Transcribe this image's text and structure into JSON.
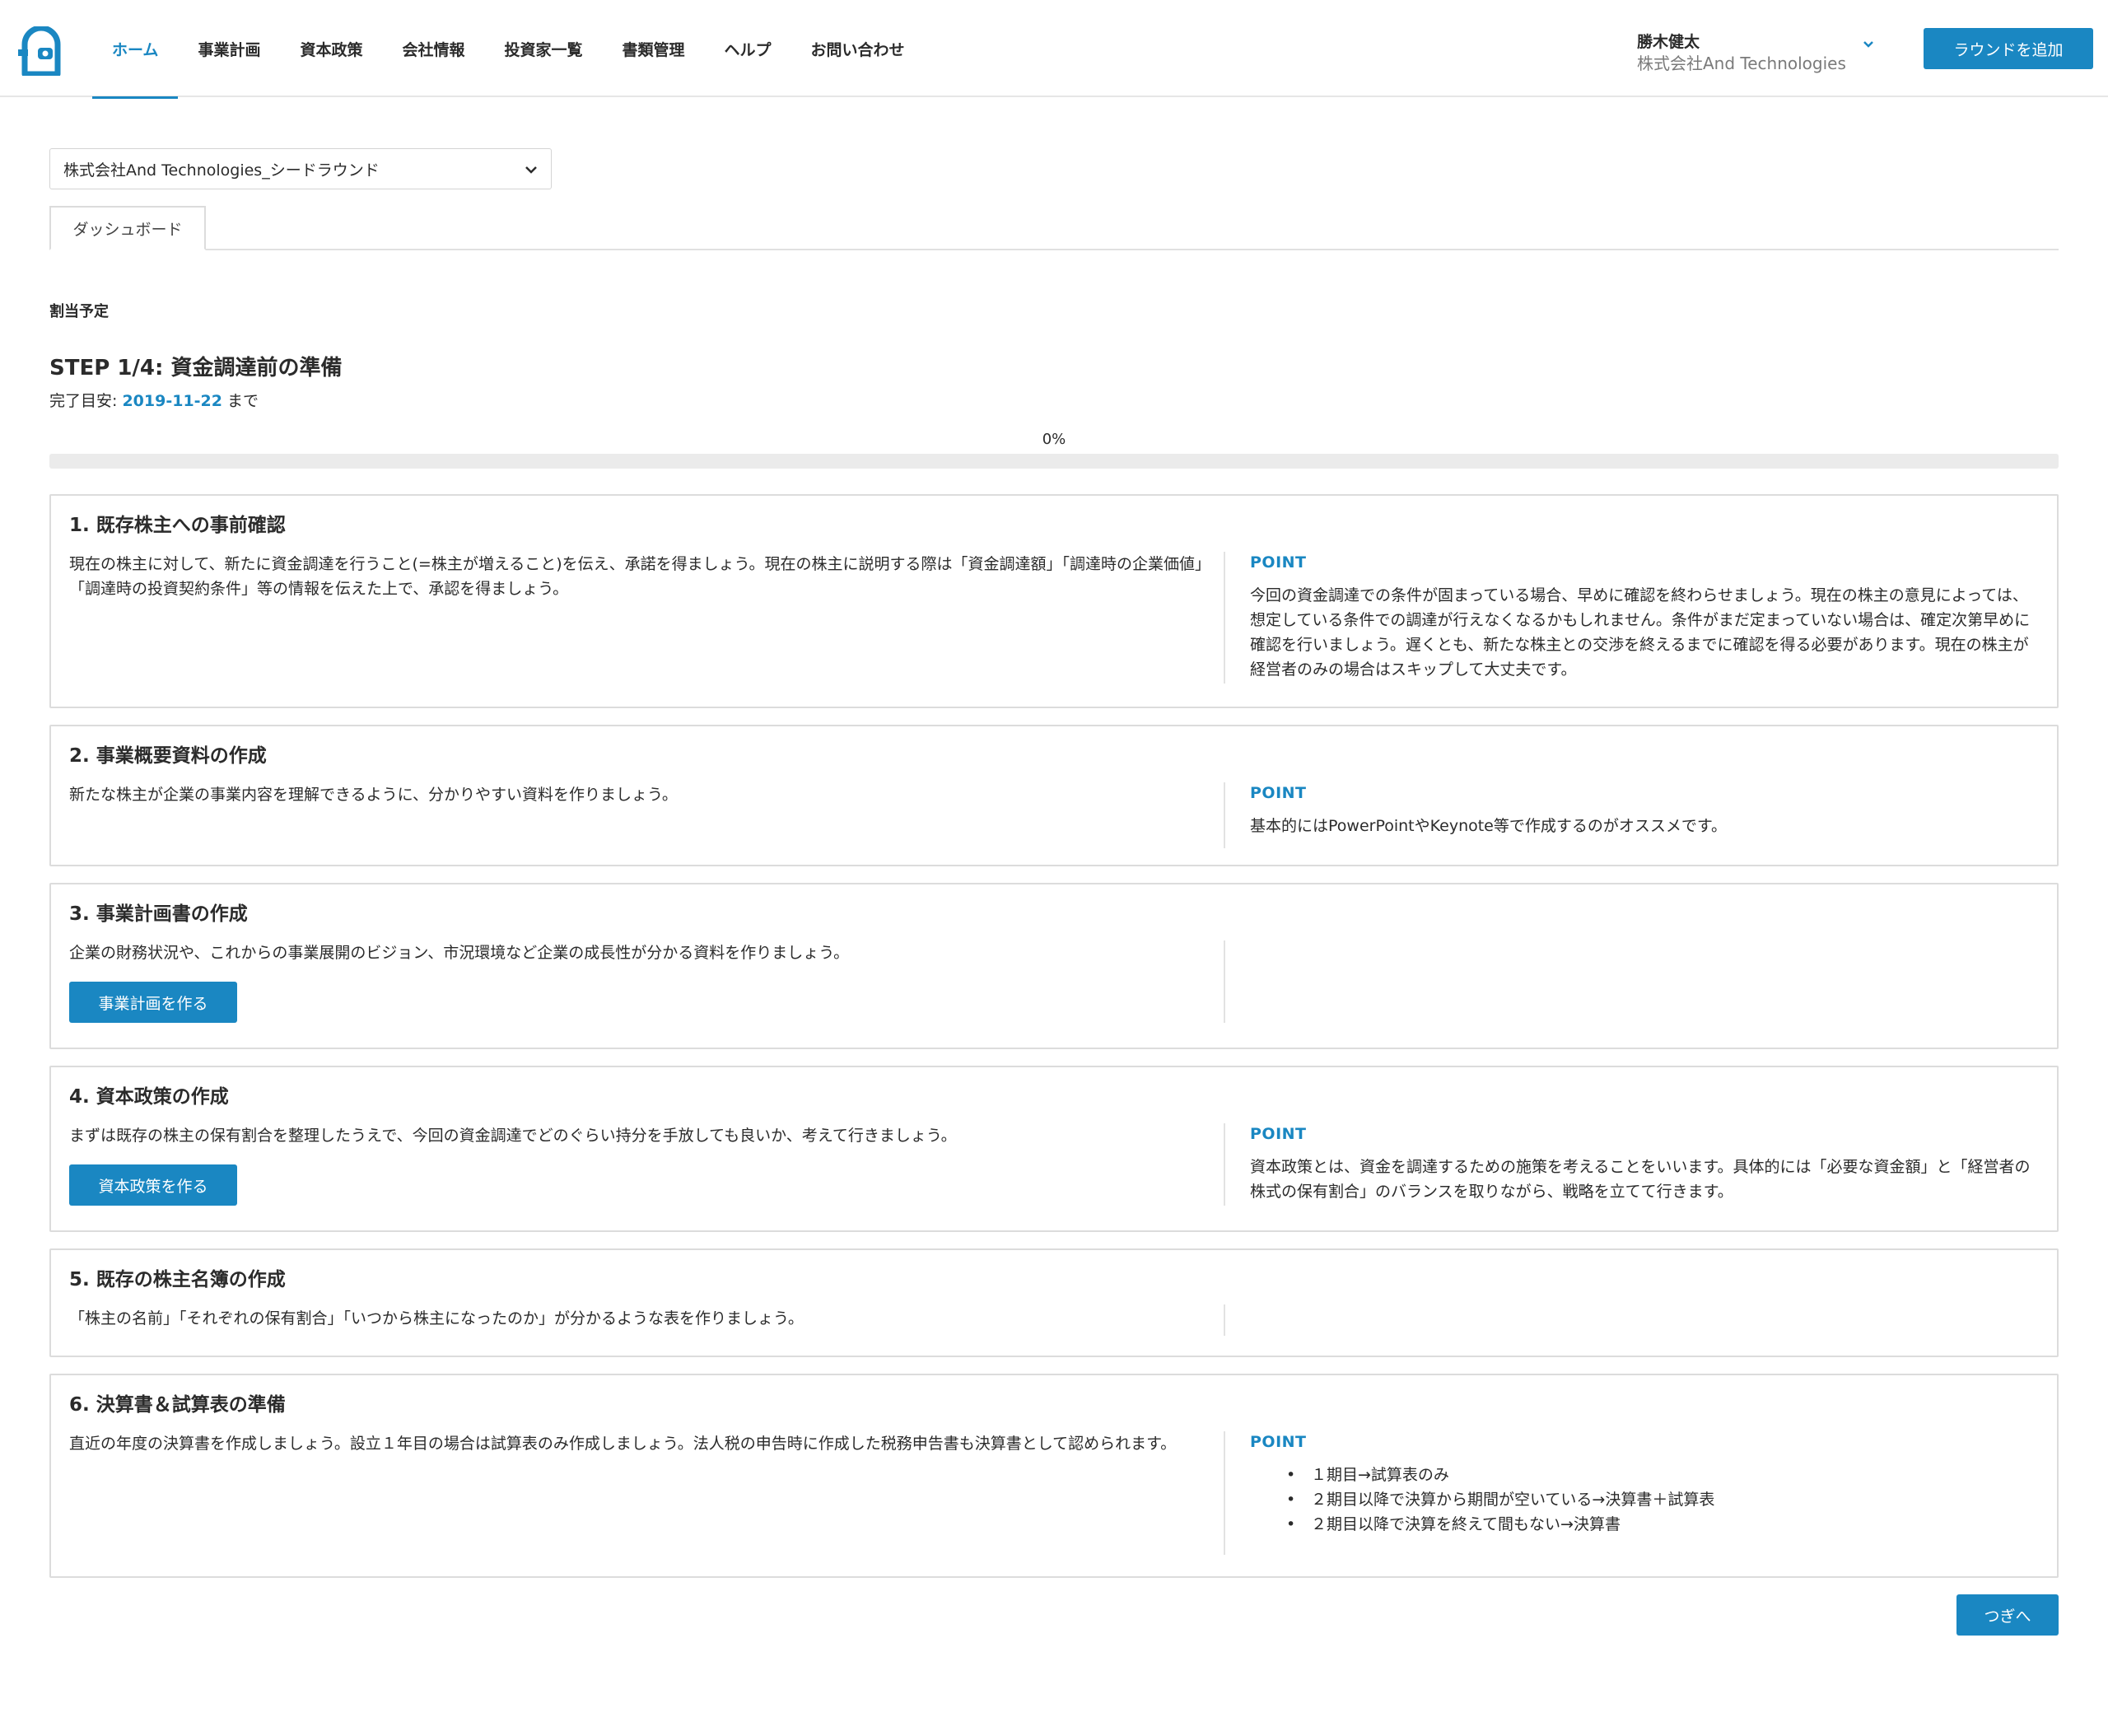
{
  "nav": {
    "items": [
      "ホーム",
      "事業計画",
      "資本政策",
      "会社情報",
      "投資家一覧",
      "書類管理",
      "ヘルプ",
      "お問い合わせ"
    ],
    "active_index": 0
  },
  "user": {
    "name": "勝木健太",
    "company": "株式会社And Technologies"
  },
  "header": {
    "add_round_label": "ラウンドを追加"
  },
  "round_select": {
    "value": "株式会社And Technologies_シードラウンド"
  },
  "tabs": [
    {
      "label": "ダッシュボード"
    }
  ],
  "section_label": "割当予定",
  "step": {
    "title": "STEP 1/4: 資金調達前の準備",
    "deadline_prefix": "完了目安: ",
    "deadline_date": "2019-11-22",
    "deadline_suffix": " まで"
  },
  "progress": {
    "label": "0%",
    "value": 0
  },
  "cards": [
    {
      "title": "1. 既存株主への事前確認",
      "desc": "現在の株主に対して、新たに資金調達を行うこと(=株主が増えること)を伝え、承諾を得ましょう。現在の株主に説明する際は「資金調達額」「調達時の企業価値」「調達時の投資契約条件」等の情報を伝えた上で、承認を得ましょう。",
      "point_label": "POINT",
      "point_text": "今回の資金調達での条件が固まっている場合、早めに確認を終わらせましょう。現在の株主の意見によっては、想定している条件での調達が行えなくなるかもしれません。条件がまだ定まっていない場合は、確定次第早めに確認を行いましょう。遅くとも、新たな株主との交渉を終えるまでに確認を得る必要があります。現在の株主が経営者のみの場合はスキップして大丈夫です。"
    },
    {
      "title": "2. 事業概要資料の作成",
      "desc": "新たな株主が企業の事業内容を理解できるように、分かりやすい資料を作りましょう。",
      "point_label": "POINT",
      "point_text": "基本的にはPowerPointやKeynote等で作成するのがオススメです。"
    },
    {
      "title": "3. 事業計画書の作成",
      "desc": "企業の財務状況や、これからの事業展開のビジョン、市況環境など企業の成長性が分かる資料を作りましょう。",
      "button_label": "事業計画を作る"
    },
    {
      "title": "4. 資本政策の作成",
      "desc": "まずは既存の株主の保有割合を整理したうえで、今回の資金調達でどのぐらい持分を手放しても良いか、考えて行きましょう。",
      "button_label": "資本政策を作る",
      "point_label": "POINT",
      "point_text": "資本政策とは、資金を調達するための施策を考えることをいいます。具体的には「必要な資金額」と「経営者の株式の保有割合」のバランスを取りながら、戦略を立てて行きます。"
    },
    {
      "title": "5. 既存の株主名簿の作成",
      "desc": "「株主の名前」「それぞれの保有割合」「いつから株主になったのか」が分かるような表を作りましょう。"
    },
    {
      "title": "6. 決算書＆試算表の準備",
      "desc": "直近の年度の決算書を作成しましょう。設立１年目の場合は試算表のみ作成しましょう。法人税の申告時に作成した税務申告書も決算書として認められます。",
      "point_label": "POINT",
      "point_list": [
        "１期目→試算表のみ",
        "２期目以降で決算から期間が空いている→決算書＋試算表",
        "２期目以降で決算を終えて間もない→決算書"
      ]
    }
  ],
  "next_label": "つぎへ",
  "colors": {
    "accent": "#1a87c2",
    "border": "#dcdcdc"
  },
  "icons": {
    "logo": "door-logo-icon",
    "user_dropdown": "chevron-down-icon",
    "select_dropdown": "chevron-down-icon"
  }
}
